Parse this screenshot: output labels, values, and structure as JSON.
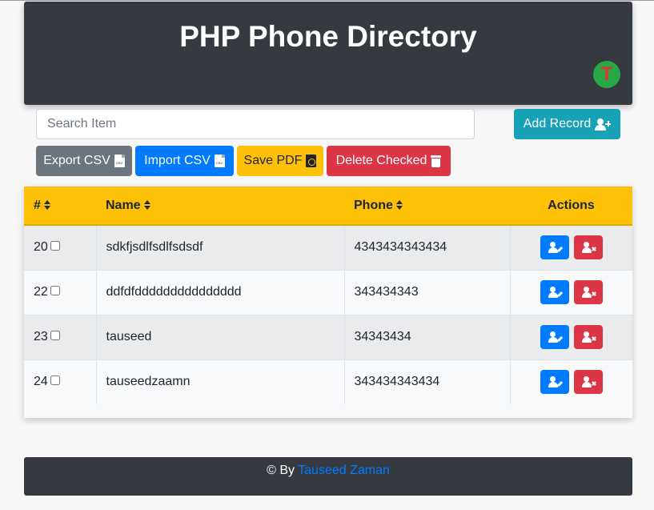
{
  "header": {
    "title": "PHP Phone Directory",
    "avatar_letter": "T"
  },
  "toolbar": {
    "search_placeholder": "Search Item",
    "add_label": "Add Record",
    "export_label": "Export CSV",
    "import_label": "Import CSV",
    "pdf_label": "Save PDF",
    "delete_label": "Delete Checked",
    "csv_icon_text": "CSV"
  },
  "table": {
    "columns": [
      "#",
      "Name",
      "Phone",
      "Actions"
    ],
    "rows": [
      {
        "id": "20",
        "name": "sdkfjsdlfsdlfsdsdf",
        "phone": "4343434343434"
      },
      {
        "id": "22",
        "name": "ddfdfddddddddddddddd",
        "phone": "343434343"
      },
      {
        "id": "23",
        "name": "tauseed",
        "phone": "34343434"
      },
      {
        "id": "24",
        "name": "tauseedzaamn",
        "phone": "343434343434"
      }
    ]
  },
  "footer": {
    "prefix": "© By",
    "author": "Tauseed Zaman"
  },
  "colors": {
    "header_bg": "#343a40",
    "table_header": "#ffc107",
    "primary": "#007bff",
    "danger": "#dc3545",
    "info": "#17a2b8",
    "secondary": "#6c757d",
    "success": "#28a745"
  }
}
